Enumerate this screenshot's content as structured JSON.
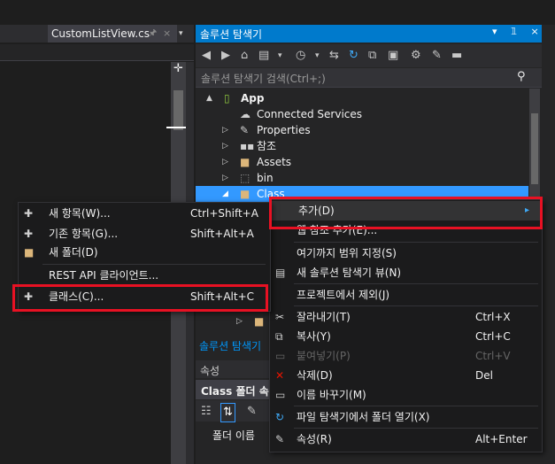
{
  "editor": {
    "tab_title": "CustomListView.cs",
    "tab_pin": "🖈",
    "tab_close": "×",
    "tab_dropdown": "▾",
    "split_button": "✛"
  },
  "solution_explorer": {
    "title": "솔루션 탐색기",
    "title_buttons": "▾ 𝟙 ×",
    "search_placeholder": "솔루션 탐색기 검색(Ctrl+;)",
    "search_icon": "⚲",
    "tree": [
      {
        "label": "App",
        "icon": "phone-icon",
        "expand": "▲",
        "bold": true
      },
      {
        "label": "Connected Services",
        "icon": "cloud-icon",
        "expand": ""
      },
      {
        "label": "Properties",
        "icon": "wrench-icon",
        "expand": "▷"
      },
      {
        "label": "참조",
        "icon": "reference-icon",
        "expand": "▷"
      },
      {
        "label": "Assets",
        "icon": "folder-icon",
        "expand": "▷"
      },
      {
        "label": "bin",
        "icon": "folder-dotted-icon",
        "expand": "▷"
      },
      {
        "label": "Class",
        "icon": "folder-icon",
        "expand": "◢"
      }
    ],
    "bottom_tab": "솔루션 탐색기"
  },
  "properties": {
    "title": "속성",
    "object": "Class 폴더 속",
    "name_label": "폴더 이름"
  },
  "main_menu": [
    {
      "label": "추가(D)",
      "shortcut": "▸",
      "icon": "",
      "highlighted": true
    },
    {
      "label": "웹 참조 추가(E)...",
      "shortcut": "",
      "icon": ""
    },
    {
      "label": "여기까지 범위 지정(S)",
      "shortcut": "",
      "icon": ""
    },
    {
      "label": "새 솔루션 탐색기 뷰(N)",
      "shortcut": "",
      "icon": "new-view-icon"
    },
    {
      "label": "프로젝트에서 제외(J)",
      "shortcut": "",
      "icon": ""
    },
    {
      "label": "잘라내기(T)",
      "shortcut": "Ctrl+X",
      "icon": "cut-icon"
    },
    {
      "label": "복사(Y)",
      "shortcut": "Ctrl+C",
      "icon": "copy-icon"
    },
    {
      "label": "붙여넣기(P)",
      "shortcut": "Ctrl+V",
      "icon": "paste-icon",
      "disabled": true
    },
    {
      "label": "삭제(D)",
      "shortcut": "Del",
      "icon": "delete-icon"
    },
    {
      "label": "이름 바꾸기(M)",
      "shortcut": "",
      "icon": "rename-icon"
    },
    {
      "label": "파일 탐색기에서 폴더 열기(X)",
      "shortcut": "",
      "icon": "refresh-icon"
    },
    {
      "label": "속성(R)",
      "shortcut": "Alt+Enter",
      "icon": "wrench-icon"
    }
  ],
  "submenu": [
    {
      "label": "새 항목(W)...",
      "shortcut": "Ctrl+Shift+A",
      "icon": "new-item-icon"
    },
    {
      "label": "기존 항목(G)...",
      "shortcut": "Shift+Alt+A",
      "icon": "existing-item-icon"
    },
    {
      "label": "새 폴더(D)",
      "shortcut": "",
      "icon": "new-folder-icon"
    },
    {
      "label": "REST API 클라이언트...",
      "shortcut": "",
      "icon": ""
    },
    {
      "label": "클래스(C)...",
      "shortcut": "Shift+Alt+C",
      "icon": "class-icon"
    }
  ],
  "colors": {
    "accent": "#007acc",
    "highlight_box": "#e81123",
    "menu_bg": "#1b1b1c"
  }
}
